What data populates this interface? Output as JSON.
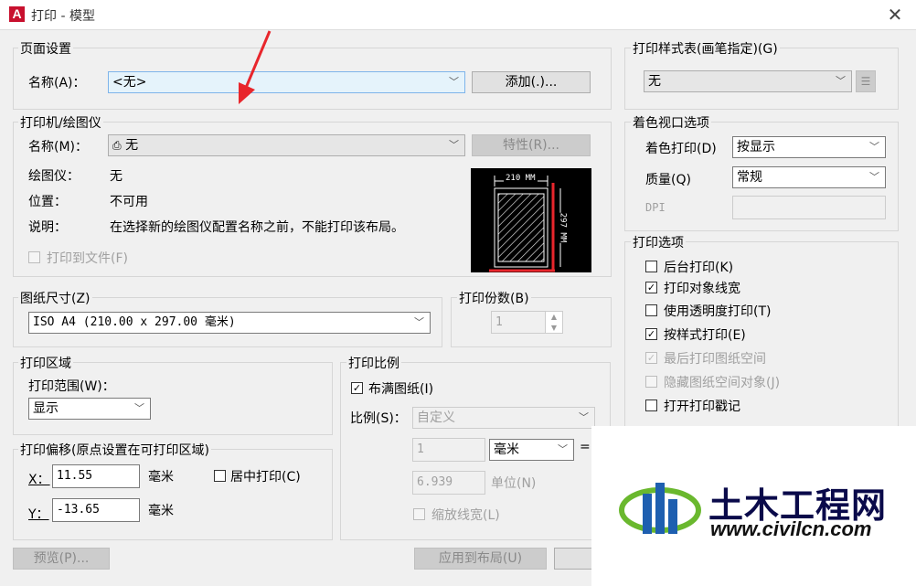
{
  "window": {
    "title": "打印 - 模型",
    "app_icon": "A",
    "close": "✕"
  },
  "page_setup": {
    "group_title": "页面设置",
    "name_label": "名称(A)：",
    "name_value": "<无>",
    "add_button": "添加(.)..."
  },
  "printer": {
    "group_title": "打印机/绘图仪",
    "name_label": "名称(M)：",
    "name_value": "无",
    "properties_button": "特性(R)...",
    "plotter_label": "绘图仪：",
    "plotter_value": "无",
    "location_label": "位置：",
    "location_value": "不可用",
    "description_label": "说明：",
    "description_value": "在选择新的绘图仪配置名称之前，不能打印该布局。",
    "print_to_file": "打印到文件(F)",
    "preview_width": "210 MM",
    "preview_height": "297 MM"
  },
  "paper_size": {
    "group_title": "图纸尺寸(Z)",
    "value": "ISO A4 (210.00 x 297.00 毫米)"
  },
  "copies": {
    "group_title": "打印份数(B)",
    "value": "1"
  },
  "plot_area": {
    "group_title": "打印区域",
    "range_label": "打印范围(W)：",
    "range_value": "显示"
  },
  "plot_offset": {
    "group_title": "打印偏移(原点设置在可打印区域)",
    "x_label": "X：",
    "x_value": "11.55",
    "x_unit": "毫米",
    "y_label": "Y：",
    "y_value": "-13.65",
    "y_unit": "毫米",
    "center": "居中打印(C)"
  },
  "plot_scale": {
    "group_title": "打印比例",
    "fit_to_paper": "布满图纸(I)",
    "scale_label": "比例(S)：",
    "scale_value": "自定义",
    "value1": "1",
    "unit_value": "毫米",
    "equals": "=",
    "value2": "6.939",
    "unit_label": "单位(N)",
    "scale_lineweights": "缩放线宽(L)"
  },
  "plot_style_table": {
    "group_title": "打印样式表(画笔指定)(G)",
    "value": "无"
  },
  "shaded_viewport": {
    "group_title": "着色视口选项",
    "shade_label": "着色打印(D)",
    "shade_value": "按显示",
    "quality_label": "质量(Q)",
    "quality_value": "常规",
    "dpi_label": "DPI"
  },
  "plot_options": {
    "group_title": "打印选项",
    "items": [
      {
        "label": "后台打印(K)",
        "checked": false,
        "disabled": false
      },
      {
        "label": "打印对象线宽",
        "checked": true,
        "disabled": false
      },
      {
        "label": "使用透明度打印(T)",
        "checked": false,
        "disabled": false
      },
      {
        "label": "按样式打印(E)",
        "checked": true,
        "disabled": false
      },
      {
        "label": "最后打印图纸空间",
        "checked": true,
        "disabled": true
      },
      {
        "label": "隐藏图纸空间对象(J)",
        "checked": false,
        "disabled": true
      },
      {
        "label": "打开打印戳记",
        "checked": false,
        "disabled": false
      }
    ]
  },
  "footer": {
    "preview_button": "预览(P)...",
    "apply_layout_button": "应用到布局(U)"
  },
  "watermark": {
    "brand": "土木工程网",
    "url": "www.civilcn.com"
  },
  "colors": {
    "accent_red": "#e8262c",
    "logo_blue": "#1e5fb0",
    "logo_green": "#6ab82e"
  }
}
